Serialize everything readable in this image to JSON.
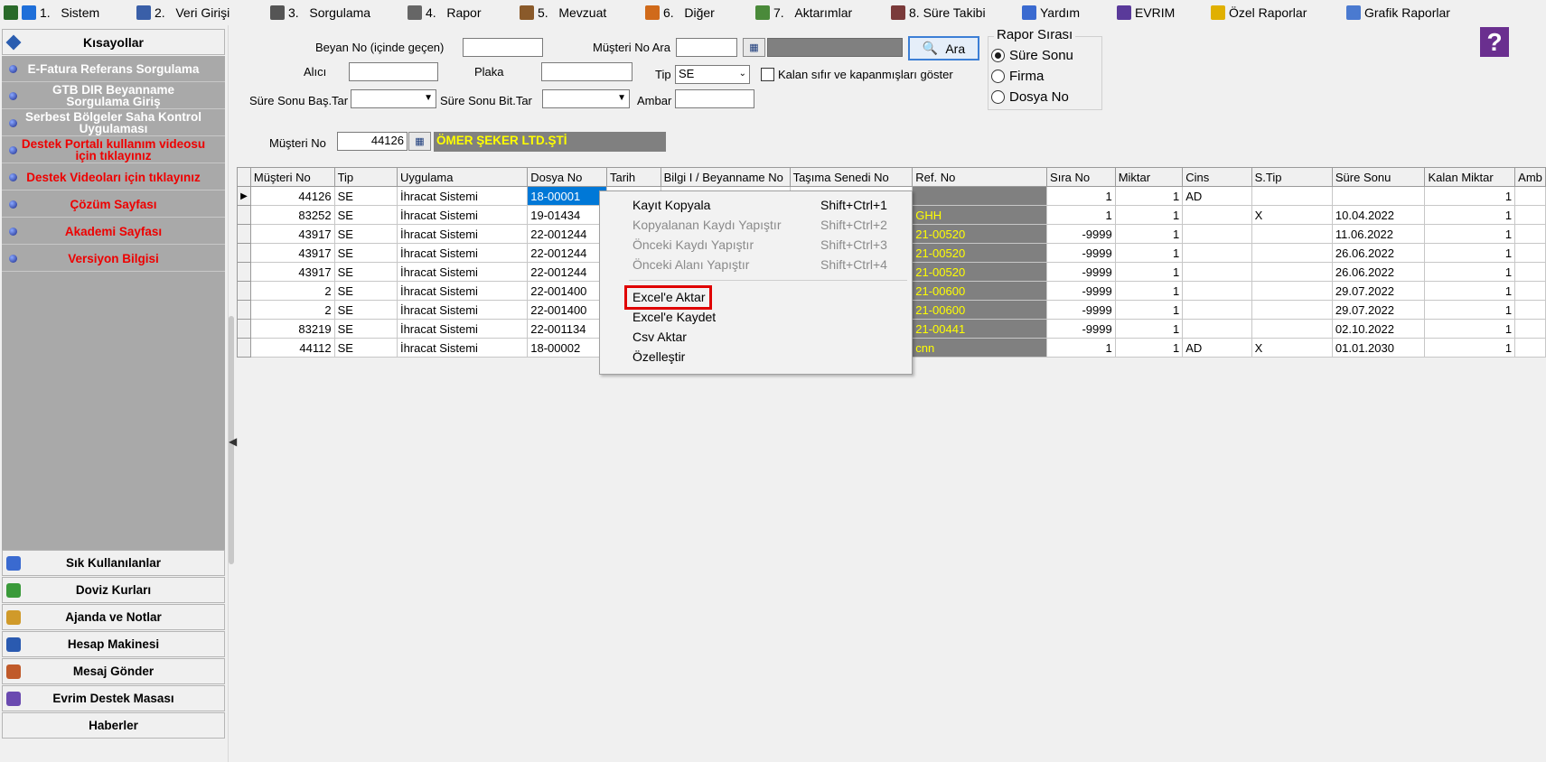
{
  "menu": [
    {
      "num": "1.",
      "label": "Sistem",
      "color": "#1e6fd9"
    },
    {
      "num": "2.",
      "label": "Veri Girişi",
      "color": "#3a5fa8"
    },
    {
      "num": "3.",
      "label": "Sorgulama",
      "color": "#555555"
    },
    {
      "num": "4.",
      "label": "Rapor",
      "color": "#666666"
    },
    {
      "num": "5.",
      "label": "Mevzuat",
      "color": "#8a5a2a"
    },
    {
      "num": "6.",
      "label": "Diğer",
      "color": "#d06a1a"
    },
    {
      "num": "7.",
      "label": "Aktarımlar",
      "color": "#4a8a3a"
    },
    {
      "num": "8.",
      "label": "Süre Takibi",
      "color": "#7a3a3a"
    },
    {
      "num": "",
      "label": "Yardım",
      "color": "#3a6ad0"
    },
    {
      "num": "",
      "label": "EVRIM",
      "color": "#5a3a9a"
    },
    {
      "num": "",
      "label": "Özel Raporlar",
      "color": "#e0b000"
    },
    {
      "num": "",
      "label": "Grafik Raporlar",
      "color": "#4a7ad0"
    }
  ],
  "sidebar": {
    "header": "Kısayollar",
    "links": [
      {
        "label": "E-Fatura Referans Sorgulama",
        "style": "white"
      },
      {
        "label": "GTB DIR Beyanname Sorgulama Giriş",
        "style": "white"
      },
      {
        "label": "Serbest Bölgeler Saha Kontrol Uygulaması",
        "style": "white"
      },
      {
        "label": "Destek Portalı kullanım videosu için tıklayınız",
        "style": "red"
      },
      {
        "label": "Destek Videoları için tıklayınız",
        "style": "red"
      },
      {
        "label": "Çözüm Sayfası",
        "style": "red"
      },
      {
        "label": "Akademi Sayfası",
        "style": "red"
      },
      {
        "label": "Versiyon Bilgisi",
        "style": "red"
      }
    ],
    "buttons": [
      {
        "label": "Sık Kullanılanlar",
        "icon": "favorites-icon",
        "color": "#3a6ad0"
      },
      {
        "label": "Doviz Kurları",
        "icon": "currency-icon",
        "color": "#3a9a3a"
      },
      {
        "label": "Ajanda ve Notlar",
        "icon": "notes-icon",
        "color": "#d09a2a"
      },
      {
        "label": "Hesap Makinesi",
        "icon": "calculator-icon",
        "color": "#2a5ab0"
      },
      {
        "label": "Mesaj Gönder",
        "icon": "users-icon",
        "color": "#c05a2a"
      },
      {
        "label": "Evrim Destek Masası",
        "icon": "support-icon",
        "color": "#6a4ab0"
      },
      {
        "label": "Haberler",
        "icon": "",
        "color": ""
      }
    ]
  },
  "filters": {
    "beyan_no_label": "Beyan No (içinde geçen)",
    "beyan_no_value": "",
    "musteri_ara_label": "Müşteri No Ara",
    "musteri_ara_value": "",
    "ara_button": "Ara",
    "alici_label": "Alıcı",
    "alici_value": "",
    "plaka_label": "Plaka",
    "plaka_value": "",
    "tip_label": "Tip",
    "tip_value": "SE",
    "kalan_label": "Kalan sıfır ve kapanmışları göster",
    "sure_bas_label": "Süre Sonu Baş.Tar",
    "sure_bas_value": "",
    "sure_bit_label": "Süre Sonu Bit.Tar",
    "sure_bit_value": "",
    "ambar_label": "Ambar",
    "ambar_value": "",
    "musteri_no_label": "Müşteri No",
    "musteri_no_value": "44126",
    "musteri_name": "ÖMER ŞEKER LTD.ŞTİ"
  },
  "rapor_sirasi": {
    "title": "Rapor Sırası",
    "options": [
      "Süre Sonu",
      "Firma",
      "Dosya No"
    ],
    "selected": "Süre Sonu"
  },
  "grid": {
    "columns": [
      "Müşteri No",
      "Tip",
      "Uygulama",
      "Dosya No",
      "Tarih",
      "Bilgi I / Beyanname No",
      "Taşıma Senedi No",
      "Ref. No",
      "Sıra No",
      "Miktar",
      "Cins",
      "S.Tip",
      "Süre Sonu",
      "Kalan Miktar",
      "Amb"
    ],
    "rows": [
      [
        "44126",
        "SE",
        "İhracat Sistemi",
        "18-00001",
        "",
        "",
        "",
        "",
        "1",
        "1",
        "AD",
        "",
        "",
        "1",
        ""
      ],
      [
        "83252",
        "SE",
        "İhracat Sistemi",
        "19-01434",
        "",
        "",
        "",
        "GHH",
        "1",
        "1",
        "",
        "X",
        "10.04.2022",
        "1",
        ""
      ],
      [
        "43917",
        "SE",
        "İhracat Sistemi",
        "22-001244",
        "",
        "",
        "",
        "21-00520",
        "-9999",
        "1",
        "",
        "",
        "11.06.2022",
        "1",
        ""
      ],
      [
        "43917",
        "SE",
        "İhracat Sistemi",
        "22-001244",
        "",
        "",
        "",
        "21-00520",
        "-9999",
        "1",
        "",
        "",
        "26.06.2022",
        "1",
        ""
      ],
      [
        "43917",
        "SE",
        "İhracat Sistemi",
        "22-001244",
        "",
        "",
        "",
        "21-00520",
        "-9999",
        "1",
        "",
        "",
        "26.06.2022",
        "1",
        ""
      ],
      [
        "2",
        "SE",
        "İhracat Sistemi",
        "22-001400",
        "",
        "",
        "",
        "21-00600",
        "-9999",
        "1",
        "",
        "",
        "29.07.2022",
        "1",
        ""
      ],
      [
        "2",
        "SE",
        "İhracat Sistemi",
        "22-001400",
        "",
        "",
        "",
        "21-00600",
        "-9999",
        "1",
        "",
        "",
        "29.07.2022",
        "1",
        ""
      ],
      [
        "83219",
        "SE",
        "İhracat Sistemi",
        "22-001134",
        "",
        "",
        "",
        "21-00441",
        "-9999",
        "1",
        "",
        "",
        "02.10.2022",
        "1",
        ""
      ],
      [
        "44112",
        "SE",
        "İhracat Sistemi",
        "18-00002",
        "",
        "",
        "",
        "cnn",
        "1",
        "1",
        "AD",
        "X",
        "01.01.2030",
        "1",
        ""
      ]
    ]
  },
  "context_menu": {
    "items": [
      {
        "label": "Kayıt Kopyala",
        "shortcut": "Shift+Ctrl+1",
        "enabled": true
      },
      {
        "label": "Kopyalanan Kaydı Yapıştır",
        "shortcut": "Shift+Ctrl+2",
        "enabled": false
      },
      {
        "label": "Önceki Kaydı Yapıştır",
        "shortcut": "Shift+Ctrl+3",
        "enabled": false
      },
      {
        "label": "Önceki Alanı Yapıştır",
        "shortcut": "Shift+Ctrl+4",
        "enabled": false
      },
      {
        "label": "Excel'e Aktar",
        "shortcut": "",
        "enabled": true
      },
      {
        "label": "Excel'e Kaydet",
        "shortcut": "",
        "enabled": true
      },
      {
        "label": "Csv Aktar",
        "shortcut": "",
        "enabled": true
      },
      {
        "label": "Özelleştir",
        "shortcut": "",
        "enabled": true
      }
    ],
    "highlighted": "Excel'e Aktar"
  },
  "colors": {
    "accent": "#0078d7",
    "highlight_box": "#e00000",
    "ref_cell_bg": "#808080",
    "ref_cell_text": "#ffff00",
    "sidebar_panel": "#a9a9a9"
  }
}
